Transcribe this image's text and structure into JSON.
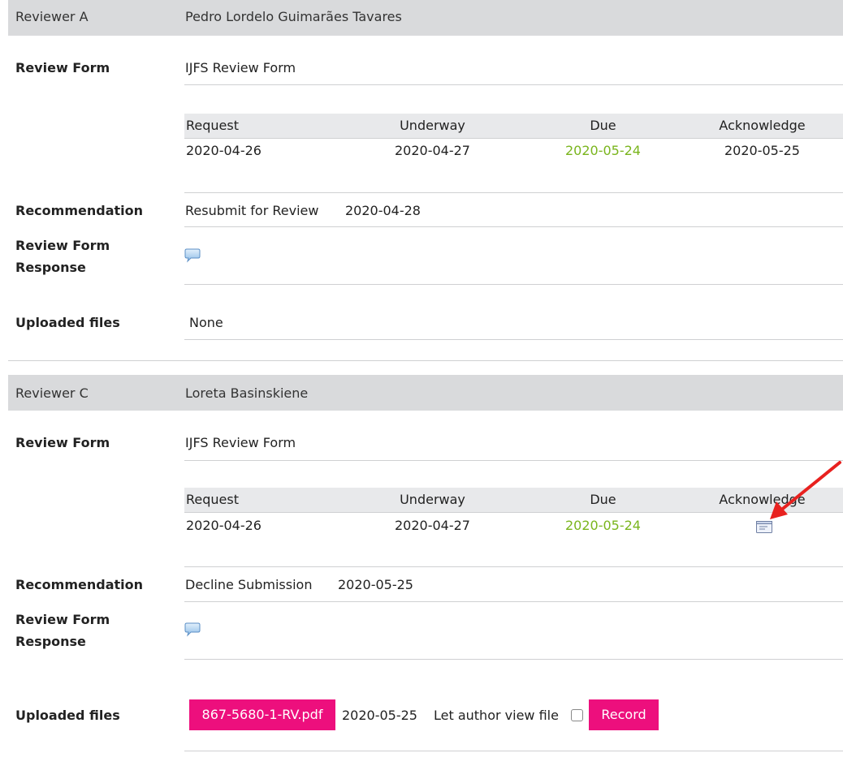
{
  "reviewers": [
    {
      "label": "Reviewer A",
      "name": "Pedro Lordelo Guimarães Tavares",
      "review_form_label": "Review Form",
      "review_form_value": "IJFS Review Form",
      "dates_headers": [
        "Request",
        "Underway",
        "Due",
        "Acknowledge"
      ],
      "dates": {
        "request": "2020-04-26",
        "underway": "2020-04-27",
        "due": "2020-05-24",
        "acknowledge": "2020-05-25"
      },
      "recommendation_label": "Recommendation",
      "recommendation_value": "Resubmit for Review",
      "recommendation_date": "2020-04-28",
      "response_label_line1": "Review Form",
      "response_label_line2": "Response",
      "response_icon": "comment-bubble-icon",
      "files_label": "Uploaded files",
      "files_value": "None"
    },
    {
      "label": "Reviewer C",
      "name": "Loreta Basinskiene",
      "review_form_label": "Review Form",
      "review_form_value": "IJFS Review Form",
      "dates_headers": [
        "Request",
        "Underway",
        "Due",
        "Acknowledge"
      ],
      "dates": {
        "request": "2020-04-26",
        "underway": "2020-04-27",
        "due": "2020-05-24",
        "acknowledge_icon": "envelope-acknowledge-icon"
      },
      "recommendation_label": "Recommendation",
      "recommendation_value": "Decline Submission",
      "recommendation_date": "2020-05-25",
      "response_label_line1": "Review Form",
      "response_label_line2": "Response",
      "response_icon": "comment-bubble-icon",
      "files_label": "Uploaded files",
      "file_name": "867-5680-1-RV.pdf",
      "file_date": "2020-05-25",
      "let_author_view_label": "Let author view file",
      "let_author_view_checked": false,
      "record_button": "Record"
    }
  ],
  "colors": {
    "due_date": "#7ab51d",
    "button_pink": "#ed0f7d",
    "annotation_arrow": "#e8211f",
    "header_band": "#d9dadc"
  }
}
